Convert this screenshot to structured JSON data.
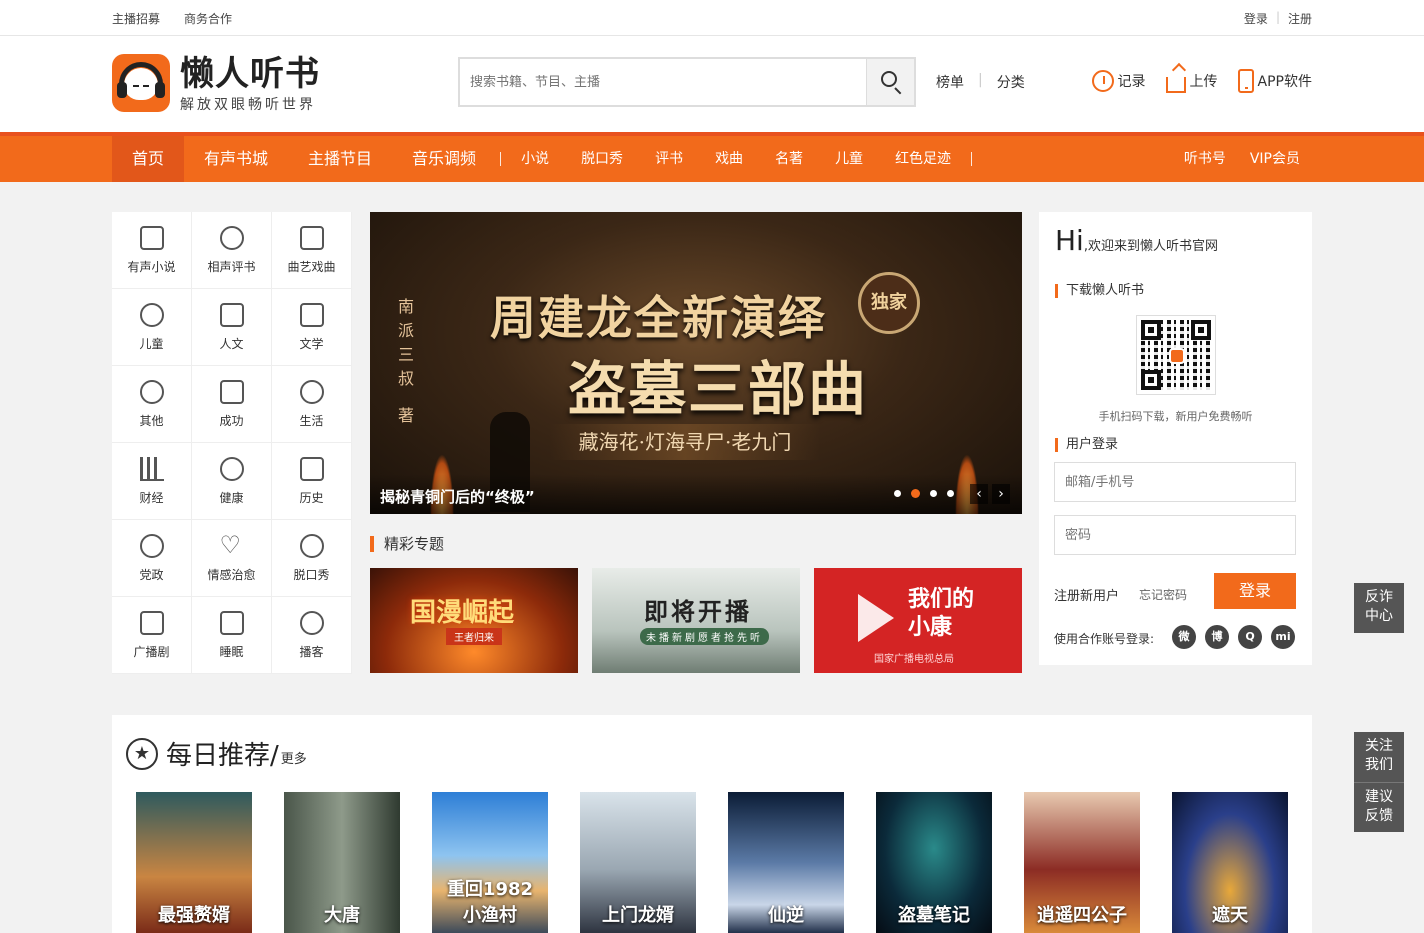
{
  "topbar": {
    "left_links": [
      "主播招募",
      "商务合作"
    ],
    "login": "登录",
    "sep": "|",
    "register": "注册"
  },
  "logo": {
    "title": "懒人听书",
    "subtitle": "解放双眼畅听世界"
  },
  "search": {
    "placeholder": "搜索书籍、节目、主播"
  },
  "header_links": {
    "rank": "榜单",
    "sep": "|",
    "category": "分类"
  },
  "header_icons": {
    "record": "记录",
    "upload": "上传",
    "app": "APP软件"
  },
  "nav": {
    "main": [
      "首页",
      "有声书城",
      "主播节目",
      "音乐调频"
    ],
    "sub": [
      "小说",
      "脱口秀",
      "评书",
      "戏曲",
      "名著",
      "儿童",
      "红色足迹"
    ],
    "right": [
      "听书号",
      "VIP会员"
    ]
  },
  "categories": [
    {
      "label": "有声小说",
      "icon": "headphones-icon"
    },
    {
      "label": "相声评书",
      "icon": "fan-icon"
    },
    {
      "label": "曲艺戏曲",
      "icon": "speaker-icon"
    },
    {
      "label": "儿童",
      "icon": "baby-icon"
    },
    {
      "label": "人文",
      "icon": "building-icon"
    },
    {
      "label": "文学",
      "icon": "book-icon"
    },
    {
      "label": "其他",
      "icon": "globe-icon"
    },
    {
      "label": "成功",
      "icon": "ruler-icon"
    },
    {
      "label": "生活",
      "icon": "cup-icon"
    },
    {
      "label": "财经",
      "icon": "bar-chart-icon"
    },
    {
      "label": "健康",
      "icon": "pill-icon"
    },
    {
      "label": "历史",
      "icon": "calendar-icon"
    },
    {
      "label": "党政",
      "icon": "party-emblem-icon"
    },
    {
      "label": "情感治愈",
      "icon": "heart-icon"
    },
    {
      "label": "脱口秀",
      "icon": "microphone-icon"
    },
    {
      "label": "广播剧",
      "icon": "radio-icon"
    },
    {
      "label": "睡眠",
      "icon": "moon-icon"
    },
    {
      "label": "播客",
      "icon": "podcast-icon"
    }
  ],
  "banner": {
    "vertical_author": "南派三叔 著",
    "line1": "周建龙全新演绎",
    "line2": "盗墓三部曲",
    "line3": "藏海花·灯海寻尸·老九门",
    "seal": "独家",
    "caption": "揭秘青铜门后的“终极”",
    "prev": "‹",
    "next": "›"
  },
  "topics": {
    "title": "精彩专题",
    "items": [
      {
        "title": "国漫崛起",
        "foot": "王者归来"
      },
      {
        "title": "即将开播",
        "foot": "未播新剧愿者抢先听"
      },
      {
        "title": "我们的小康",
        "foot": "国家广播电视总局"
      }
    ]
  },
  "panel": {
    "hi": "Hi",
    "welcome": ",欢迎来到懒人听书官网",
    "download_title": "下载懒人听书",
    "qr_tip": "手机扫码下载，新用户免费畅听",
    "login_title": "用户登录",
    "email_placeholder": "邮箱/手机号",
    "password_placeholder": "密码",
    "register": "注册新用户",
    "forgot": "忘记密码",
    "login_button": "登录",
    "partner_label": "使用合作账号登录:",
    "social": [
      "wechat-icon",
      "weibo-icon",
      "qq-icon",
      "xiaomi-icon"
    ],
    "social_glyphs": [
      "微",
      "博",
      "Q",
      "mi"
    ]
  },
  "daily": {
    "title": "每日推荐/",
    "more": "更多",
    "books": [
      {
        "title": "最强赘婿"
      },
      {
        "title": "大唐"
      },
      {
        "title": "重回1982小渔村"
      },
      {
        "title": "上门龙婿"
      },
      {
        "title": "仙逆"
      },
      {
        "title": "盗墓笔记"
      },
      {
        "title": "逍遥四公子"
      },
      {
        "title": "遮天"
      }
    ]
  },
  "floating": {
    "report": [
      "反诈",
      "中心"
    ],
    "follow": [
      "关注",
      "我们"
    ],
    "feedback": [
      "建议",
      "反馈"
    ]
  }
}
